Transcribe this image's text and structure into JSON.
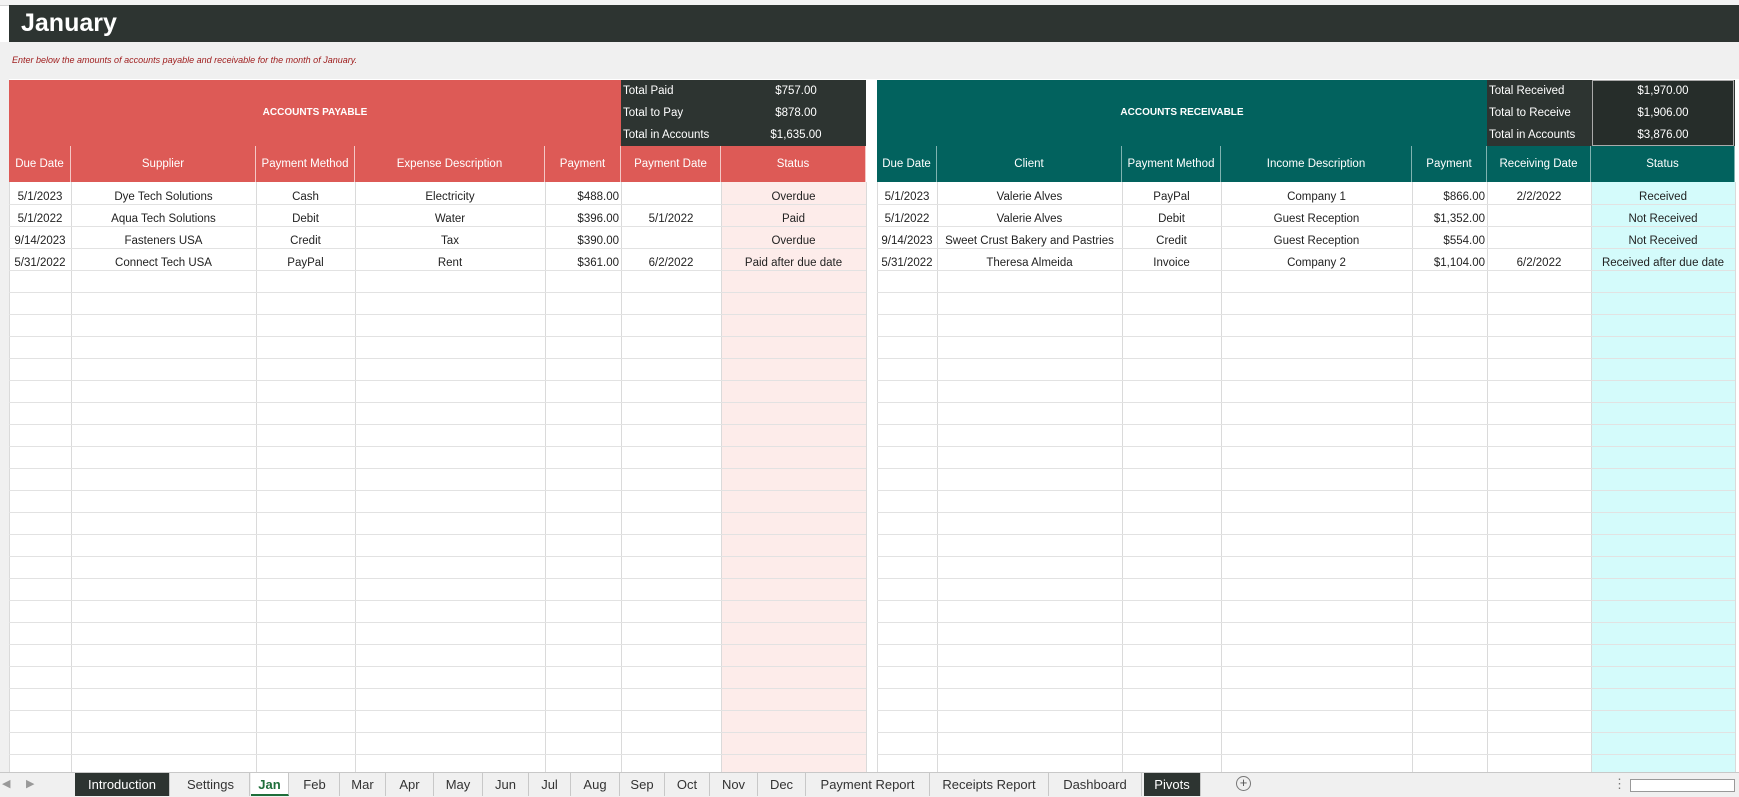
{
  "sheet": {
    "title": "January",
    "subtitle": "Enter below the amounts of accounts payable and receivable for the month of January."
  },
  "payable": {
    "title": "ACCOUNTS PAYABLE",
    "totals": [
      {
        "label": "Total Paid",
        "value": "$757.00"
      },
      {
        "label": "Total to Pay",
        "value": "$878.00"
      },
      {
        "label": "Total in Accounts",
        "value": "$1,635.00"
      }
    ],
    "headers": [
      "Due Date",
      "Supplier",
      "Payment Method",
      "Expense Description",
      "Payment",
      "Payment Date",
      "Status"
    ],
    "rows": [
      [
        "5/1/2023",
        "Dye Tech Solutions",
        "Cash",
        "Electricity",
        "$488.00",
        "",
        "Overdue"
      ],
      [
        "5/1/2022",
        "Aqua Tech Solutions",
        "Debit",
        "Water",
        "$396.00",
        "5/1/2022",
        "Paid"
      ],
      [
        "9/14/2023",
        "Fasteners USA",
        "Credit",
        "Tax",
        "$390.00",
        "",
        "Overdue"
      ],
      [
        "5/31/2022",
        "Connect Tech USA",
        "PayPal",
        "Rent",
        "$361.00",
        "6/2/2022",
        "Paid after due date"
      ]
    ],
    "accent": "#dd5a56"
  },
  "receivable": {
    "title": "ACCOUNTS RECEIVABLE",
    "totals": [
      {
        "label": "Total Received",
        "value": "$1,970.00"
      },
      {
        "label": "Total to Receive",
        "value": "$1,906.00"
      },
      {
        "label": "Total in Accounts",
        "value": "$3,876.00"
      }
    ],
    "headers": [
      "Due Date",
      "Client",
      "Payment Method",
      "Income Description",
      "Payment",
      "Receiving Date",
      "Status"
    ],
    "rows": [
      [
        "5/1/2023",
        "Valerie Alves",
        "PayPal",
        "Company 1",
        "$866.00",
        "2/2/2022",
        "Received"
      ],
      [
        "5/1/2022",
        "Valerie Alves",
        "Debit",
        "Guest Reception",
        "$1,352.00",
        "",
        "Not Received"
      ],
      [
        "9/14/2023",
        "Sweet Crust Bakery and Pastries",
        "Credit",
        "Guest Reception",
        "$554.00",
        "",
        "Not Received"
      ],
      [
        "5/31/2022",
        "Theresa Almeida",
        "Invoice",
        "Company 2",
        "$1,104.00",
        "6/2/2022",
        "Received after due date"
      ]
    ],
    "accent": "#02625e"
  },
  "tabs": [
    {
      "label": "Introduction",
      "style": "dark"
    },
    {
      "label": "Settings",
      "style": "normal"
    },
    {
      "label": "Jan",
      "style": "active"
    },
    {
      "label": "Feb",
      "style": "normal"
    },
    {
      "label": "Mar",
      "style": "normal"
    },
    {
      "label": "Apr",
      "style": "normal"
    },
    {
      "label": "May",
      "style": "normal"
    },
    {
      "label": "Jun",
      "style": "normal"
    },
    {
      "label": "Jul",
      "style": "normal"
    },
    {
      "label": "Aug",
      "style": "normal"
    },
    {
      "label": "Sep",
      "style": "normal"
    },
    {
      "label": "Oct",
      "style": "normal"
    },
    {
      "label": "Nov",
      "style": "normal"
    },
    {
      "label": "Dec",
      "style": "normal"
    },
    {
      "label": "Payment Report",
      "style": "normal"
    },
    {
      "label": "Receipts Report",
      "style": "normal"
    },
    {
      "label": "Dashboard",
      "style": "normal"
    },
    {
      "label": "Pivots",
      "style": "dark"
    }
  ],
  "icons": {
    "add_sheet": "plus-circle-icon",
    "scroll_left": "arrow-left-icon",
    "scroll_right": "arrow-right-icon"
  }
}
